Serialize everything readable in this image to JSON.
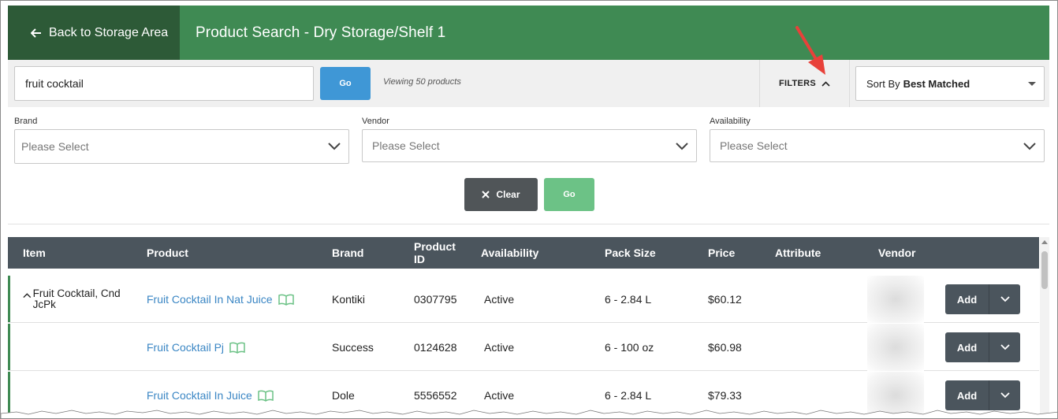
{
  "header": {
    "back_label": "Back to Storage Area",
    "title": "Product Search - Dry Storage/Shelf 1",
    "color": "#3f8a53"
  },
  "search": {
    "value": "fruit cocktail",
    "go_label": "Go",
    "viewing_text": "Viewing 50 products"
  },
  "filters_toggle": {
    "label": "FILTERS",
    "icon": "chevron-up-icon"
  },
  "sort": {
    "prefix": "Sort By",
    "value": "Best Matched"
  },
  "filters": [
    {
      "label": "Brand",
      "placeholder": "Please Select"
    },
    {
      "label": "Vendor",
      "placeholder": "Please Select"
    },
    {
      "label": "Availability",
      "placeholder": "Please Select"
    }
  ],
  "filter_actions": {
    "clear_label": "Clear",
    "go_label": "Go"
  },
  "table": {
    "columns": [
      "Item",
      "Product",
      "Brand",
      "Product ID",
      "Availability",
      "Pack Size",
      "Price",
      "Attribute",
      "Vendor"
    ],
    "rows": [
      {
        "item": "Fruit Cocktail, Cnd JcPk",
        "product": "Fruit Cocktail In Nat Juice",
        "brand": "Kontiki",
        "product_id": "0307795",
        "availability": "Active",
        "pack_size": "6 - 2.84 L",
        "price": "$60.12",
        "attribute": "",
        "add_label": "Add"
      },
      {
        "item": "",
        "product": "Fruit Cocktail Pj",
        "brand": "Success",
        "product_id": "0124628",
        "availability": "Active",
        "pack_size": "6 - 100 oz",
        "price": "$60.98",
        "attribute": "",
        "add_label": "Add"
      },
      {
        "item": "",
        "product": "Fruit Cocktail In Juice",
        "brand": "Dole",
        "product_id": "5556552",
        "availability": "Active",
        "pack_size": "6 - 2.84 L",
        "price": "$79.33",
        "attribute": "",
        "add_label": "Add"
      }
    ]
  }
}
